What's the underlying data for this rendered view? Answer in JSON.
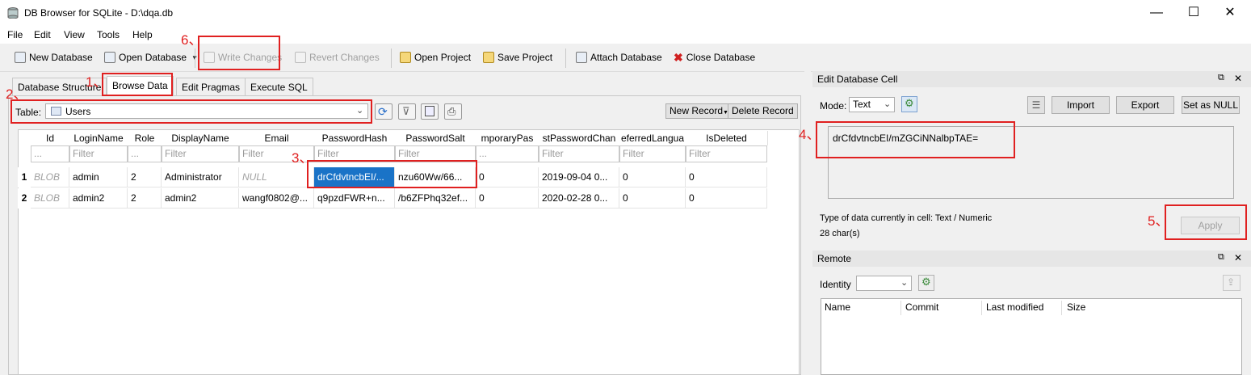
{
  "window": {
    "title": "DB Browser for SQLite - D:\\dqa.db",
    "minimize": "—",
    "maximize": "☐",
    "close": "✕"
  },
  "menu": [
    "File",
    "Edit",
    "View",
    "Tools",
    "Help"
  ],
  "toolbar": {
    "new_database": "New Database",
    "open_database": "Open Database",
    "write_changes": "Write Changes",
    "revert_changes": "Revert Changes",
    "open_project": "Open Project",
    "save_project": "Save Project",
    "attach_database": "Attach Database",
    "close_database": "Close Database"
  },
  "tabs": [
    "Database Structure",
    "Browse Data",
    "Edit Pragmas",
    "Execute SQL"
  ],
  "browse": {
    "table_label": "Table:",
    "table_value": "Users",
    "new_record": "New Record",
    "delete_record": "Delete Record",
    "filter_placeholder": "Filter",
    "filter_dots": "...",
    "columns": [
      "Id",
      "LoginName",
      "Role",
      "DisplayName",
      "Email",
      "PasswordHash",
      "PasswordSalt",
      "mporaryPas",
      "stPasswordChan",
      "eferredLangua",
      "IsDeleted"
    ],
    "rows": [
      {
        "num": "1",
        "cells": [
          "BLOB",
          "admin",
          "2",
          "Administrator",
          "NULL",
          "drCfdvtncbEI/...",
          "nzu60Ww/66...",
          "0",
          "2019-09-04 0...",
          "0",
          "0"
        ]
      },
      {
        "num": "2",
        "cells": [
          "BLOB",
          "admin2",
          "2",
          "admin2",
          "wangf0802@...",
          "q9pzdFWR+n...",
          "/b6ZFPhq32ef...",
          "0",
          "2020-02-28 0...",
          "0",
          "0"
        ]
      }
    ]
  },
  "edit_cell": {
    "title": "Edit Database Cell",
    "mode_label": "Mode:",
    "mode_value": "Text",
    "import": "Import",
    "export": "Export",
    "set_null": "Set as NULL",
    "value": "drCfdvtncbEI/mZGCiNNalbpTAE=",
    "type_info": "Type of data currently in cell: Text / Numeric",
    "char_count": "28 char(s)",
    "apply": "Apply"
  },
  "remote": {
    "title": "Remote",
    "identity_label": "Identity",
    "columns": [
      "Name",
      "Commit",
      "Last modified",
      "Size"
    ]
  },
  "annotations": [
    "1、",
    "2、",
    "3、",
    "4、",
    "5、",
    "6、"
  ],
  "colors": {
    "annotation": "#e02020",
    "selection": "#1a73c7"
  }
}
